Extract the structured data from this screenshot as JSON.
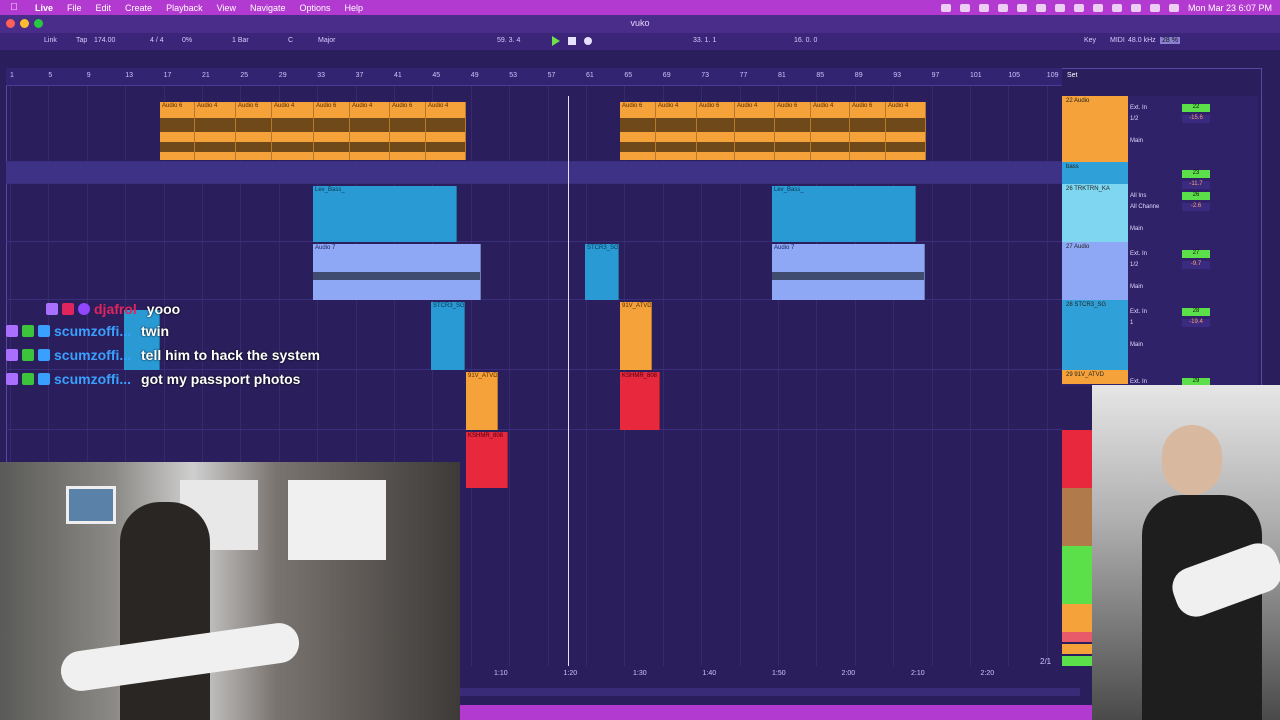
{
  "menubar": {
    "app": "Live",
    "items": [
      "File",
      "Edit",
      "Create",
      "Playback",
      "View",
      "Navigate",
      "Options",
      "Help"
    ],
    "clock": "Mon Mar 23  6:07 PM"
  },
  "window": {
    "title": "vuko"
  },
  "control": {
    "link": "Link",
    "tap": "Tap",
    "tempo": "174.00",
    "time_sig": "4 / 4",
    "percent": "0%",
    "quant": "1 Bar",
    "key_root": "C",
    "scale": "Major",
    "position": "59.  3.  4",
    "loop_start": "33.  1.  1",
    "loop_length": "16.  0.  0",
    "key": "Key",
    "midi": "MIDI",
    "sample_rate": "48.0 kHz",
    "cpu": "28 %"
  },
  "ruler": {
    "bars": [
      "1",
      "5",
      "9",
      "13",
      "17",
      "21",
      "25",
      "29",
      "33",
      "37",
      "41",
      "45",
      "49",
      "53",
      "57",
      "61",
      "65",
      "69",
      "73",
      "77",
      "81",
      "85",
      "89",
      "93",
      "97",
      "101",
      "105",
      "109"
    ],
    "set_label": "Set"
  },
  "tracks": [
    {
      "name": "22 Audio",
      "color": "#f5a23a",
      "input": "Ext. In",
      "ch": "1/2",
      "num": "22",
      "vol": "-15.6",
      "out": "Main"
    },
    {
      "name": "bass",
      "color": "#2fa0d8",
      "input": "",
      "ch": "",
      "num": "23",
      "vol": "-11.7",
      "out": "Main"
    },
    {
      "name": "26 TRKTRN_KA",
      "color": "#7fd6f0",
      "input": "All Ins",
      "ch": "All Channe",
      "num": "26",
      "vol": "-2.6",
      "out": "Main"
    },
    {
      "name": "27 Audio",
      "color": "#8fa8f5",
      "input": "Ext. In",
      "ch": "1/2",
      "num": "27",
      "vol": "-9.7",
      "out": "Main"
    },
    {
      "name": "28 STCR3_SG",
      "color": "#2fa0d8",
      "input": "Ext. In",
      "ch": "1",
      "num": "28",
      "vol": "-19.4",
      "out": "Main"
    },
    {
      "name": "29 91V_ATVD",
      "color": "#f5a23a",
      "input": "Ext. In",
      "ch": "",
      "num": "29",
      "vol": "",
      "out": ""
    }
  ],
  "clips": {
    "audio6": "Audio 6",
    "audio4": "Audio 4",
    "audio7": "Audio 7",
    "bass": "Lev_Bass_",
    "stcr3": "STCR3_SG",
    "v91": "91V_ATVD",
    "kshmr": "KSHMR_808"
  },
  "timeline": [
    "1:10",
    "1:20",
    "1:30",
    "1:40",
    "1:50",
    "2:00",
    "2:10",
    "2:20"
  ],
  "pager": "2/1",
  "chat": [
    {
      "user": "djafrol",
      "message": "yooo",
      "color": "#e0245e"
    },
    {
      "user": "scumzoffi...",
      "message": "twin",
      "color": "#3aa0ff"
    },
    {
      "user": "scumzoffi...",
      "message": "tell him to hack the system",
      "color": "#3aa0ff"
    },
    {
      "user": "scumzoffi...",
      "message": "got my passport photos",
      "color": "#3aa0ff"
    }
  ],
  "colors": {
    "menubar": "#b33ad0",
    "orange": "#f5a23a",
    "blue": "#2fa0d8",
    "periwinkle": "#8fa8f5",
    "red": "#e8283c",
    "green": "#5ce04a"
  }
}
